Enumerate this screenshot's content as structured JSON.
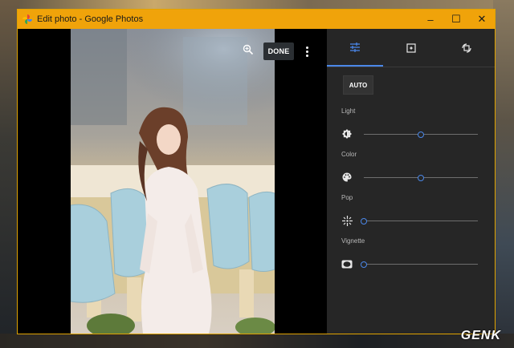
{
  "window": {
    "title": "Edit photo - Google Photos"
  },
  "window_controls": {
    "minimize": "–",
    "maximize": "☐",
    "close": "✕"
  },
  "toolbar": {
    "done_label": "DONE"
  },
  "panel": {
    "tabs": [
      {
        "name": "adjust",
        "icon": "sliders-icon",
        "active": true
      },
      {
        "name": "filters",
        "icon": "filter-icon",
        "active": false
      },
      {
        "name": "crop-rotate",
        "icon": "rotate-crop-icon",
        "active": false
      }
    ],
    "auto_label": "AUTO",
    "sliders": [
      {
        "label": "Light",
        "icon": "brightness-icon",
        "value": 0.5
      },
      {
        "label": "Color",
        "icon": "palette-icon",
        "value": 0.5
      },
      {
        "label": "Pop",
        "icon": "sparkle-icon",
        "value": 0.0
      },
      {
        "label": "Vignette",
        "icon": "vignette-icon",
        "value": 0.0
      }
    ]
  },
  "watermark": "GENK",
  "colors": {
    "titlebar": "#f0a30a",
    "accent": "#4a87e8",
    "panel_bg": "#262626"
  }
}
